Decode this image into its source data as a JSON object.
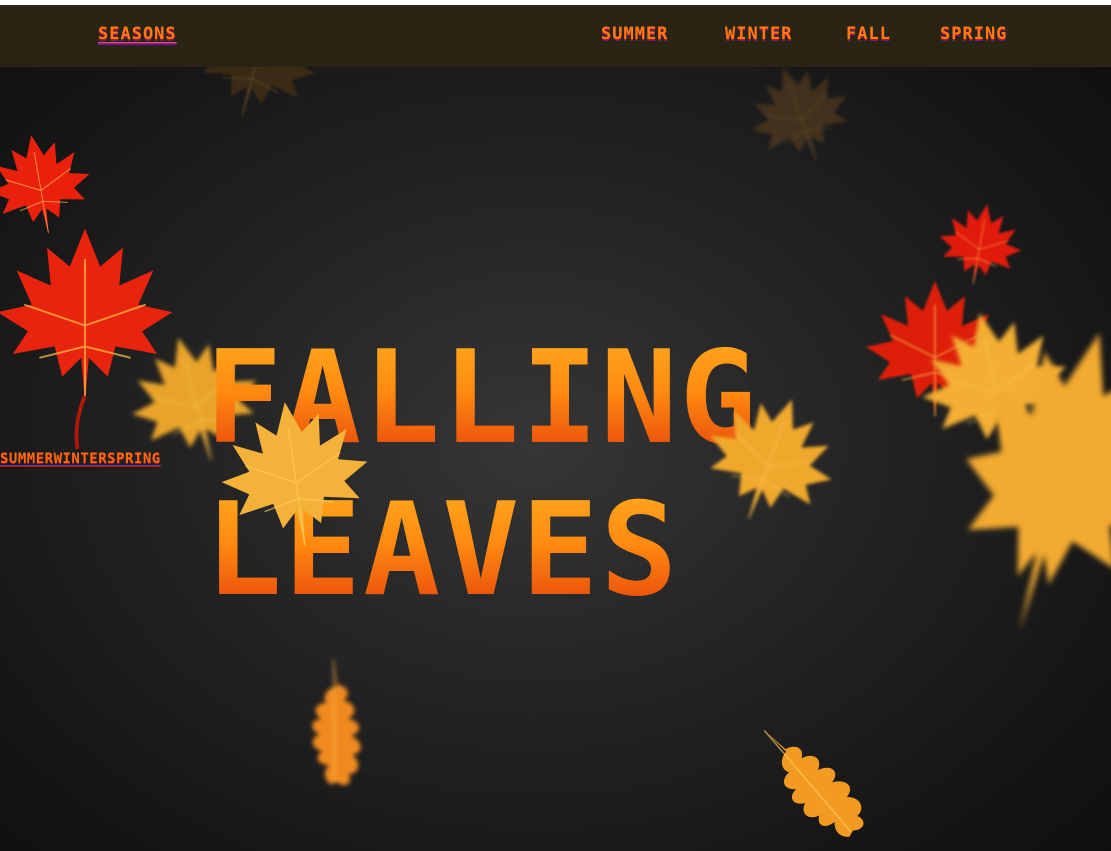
{
  "navbar": {
    "brand": "Seasons",
    "links": [
      "Summer",
      "Winter",
      "Fall",
      "Spring"
    ]
  },
  "side_links": [
    "Summer",
    "Winter",
    "Spring"
  ],
  "hero": {
    "line1": "Falling",
    "line2": "Leaves"
  },
  "colors": {
    "accent_orange": "#ff7a12",
    "accent_red": "#d8200a",
    "leaf_yellow": "#f6b133",
    "leaf_red": "#e8200c",
    "nav_bg": "#2a2414"
  },
  "decorations": {
    "leaf_icon": "maple-leaf-icon",
    "oak_icon": "oak-leaf-icon"
  }
}
